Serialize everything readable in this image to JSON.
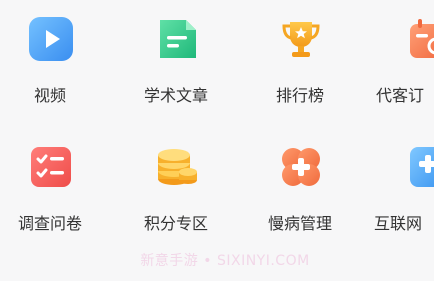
{
  "grid": {
    "items": [
      {
        "label": "视频",
        "icon": "video-play-icon",
        "color": "#4aa3f5"
      },
      {
        "label": "学术文章",
        "icon": "article-document-icon",
        "color": "#2ec78a"
      },
      {
        "label": "排行榜",
        "icon": "trophy-icon",
        "color": "#f5a623"
      },
      {
        "label": "代客订",
        "icon": "calendar-clock-icon",
        "color": "#f47c52"
      },
      {
        "label": "调查问卷",
        "icon": "survey-checklist-icon",
        "color": "#f0605d"
      },
      {
        "label": "积分专区",
        "icon": "coins-icon",
        "color": "#f5a623"
      },
      {
        "label": "慢病管理",
        "icon": "medical-cross-icon",
        "color": "#f47c52"
      },
      {
        "label": "互联网",
        "icon": "internet-hospital-plus-icon",
        "color": "#4aa3f5"
      }
    ]
  },
  "watermark": "新意手游 • SIXINYI.COM"
}
